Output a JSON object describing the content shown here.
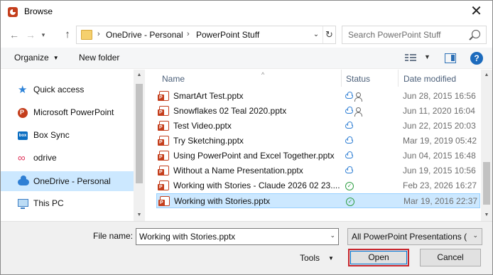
{
  "window": {
    "title": "Browse",
    "close_glyph": "✕"
  },
  "address": {
    "crumbs": [
      "OneDrive - Personal",
      "PowerPoint Stuff"
    ],
    "separator": "›"
  },
  "search": {
    "placeholder": "Search PowerPoint Stuff"
  },
  "toolbar": {
    "organize": "Organize",
    "new_folder": "New folder",
    "help": "?"
  },
  "sidebar": {
    "items": [
      {
        "label": "Quick access",
        "icon": "quick-access-star-icon"
      },
      {
        "label": "Microsoft PowerPoint",
        "icon": "powerpoint-icon"
      },
      {
        "label": "Box Sync",
        "icon": "box-icon"
      },
      {
        "label": "odrive",
        "icon": "odrive-icon"
      },
      {
        "label": "OneDrive - Personal",
        "icon": "onedrive-cloud-icon",
        "selected": true
      },
      {
        "label": "This PC",
        "icon": "computer-icon"
      }
    ]
  },
  "columns": {
    "name": "Name",
    "status": "Status",
    "date": "Date modified"
  },
  "files": [
    {
      "name": "SmartArt Test.pptx",
      "status": "cloud-shared",
      "date": "Jun 28, 2015 16:56"
    },
    {
      "name": "Snowflakes 02 Teal 2020.pptx",
      "status": "cloud-shared",
      "date": "Jun 11, 2020 16:04"
    },
    {
      "name": "Test Video.pptx",
      "status": "cloud",
      "date": "Jun 22, 2015 20:03"
    },
    {
      "name": "Try Sketching.pptx",
      "status": "cloud",
      "date": "Mar 19, 2019 05:42"
    },
    {
      "name": "Using PowerPoint and Excel Together.pptx",
      "status": "cloud",
      "date": "Jun 04, 2015 16:48"
    },
    {
      "name": "Without a Name Presentation.pptx",
      "status": "cloud",
      "date": "Jun 19, 2015 10:56"
    },
    {
      "name": "Working with Stories - Claude 2026 02 23....",
      "status": "synced",
      "date": "Feb 23, 2026 16:27"
    },
    {
      "name": "Working with Stories.pptx",
      "status": "synced",
      "date": "Mar 19, 2016 22:37",
      "selected": true
    }
  ],
  "footer": {
    "file_name_label": "File name:",
    "file_name_value": "Working with Stories.pptx",
    "file_type": "All PowerPoint Presentations (*",
    "tools": "Tools",
    "open": "Open",
    "cancel": "Cancel"
  },
  "colors": {
    "selection": "#cce8ff",
    "open_highlight": "#c8262d",
    "accent": "#0078d7"
  }
}
